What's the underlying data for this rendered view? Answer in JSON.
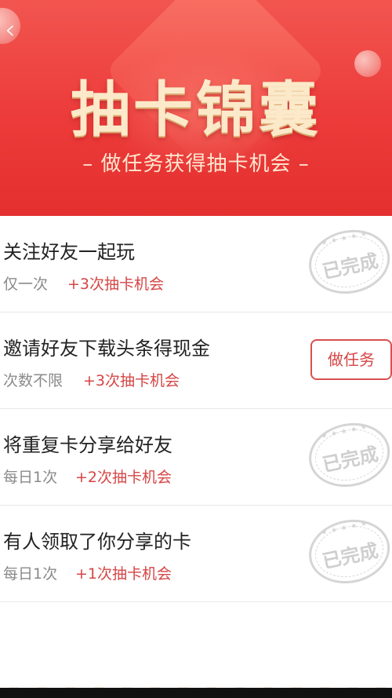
{
  "header": {
    "back_icon": "chevron-left-icon",
    "back_glyph": "‹",
    "title": "抽卡锦囊",
    "subtitle": "– 做任务获得抽卡机会 –"
  },
  "tasks": [
    {
      "name": "关注好友一起玩",
      "limit": "仅一次",
      "reward": "+3次抽卡机会",
      "status": "已完成"
    },
    {
      "name": "邀请好友下载头条得现金",
      "limit": "次数不限",
      "reward": "+3次抽卡机会",
      "action_label": "做任务"
    },
    {
      "name": "将重复卡分享给好友",
      "limit": "每日1次",
      "reward": "+2次抽卡机会",
      "status": "已完成"
    },
    {
      "name": "有人领取了你分享的卡",
      "limit": "每日1次",
      "reward": "+1次抽卡机会",
      "status": "已完成"
    }
  ],
  "stamp_stars": "★ ★ ★ ★ ★",
  "colors": {
    "accent": "#ec3b3a",
    "reward": "#d64545",
    "title": "#fbe9c9"
  }
}
